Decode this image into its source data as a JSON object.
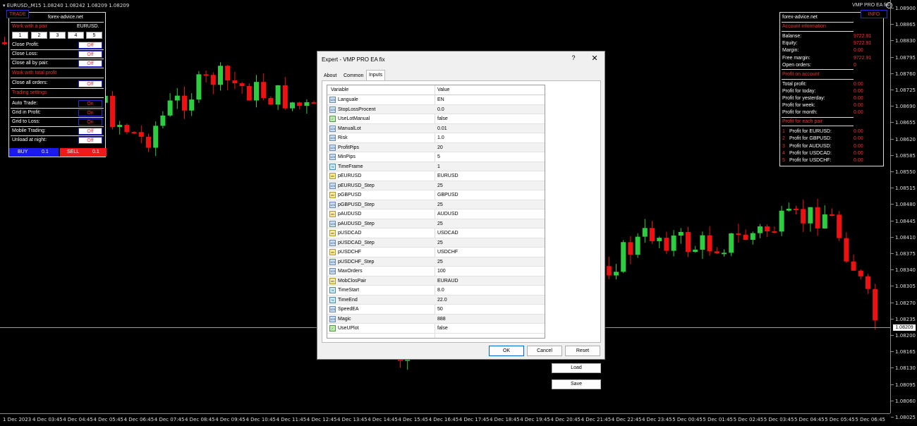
{
  "chart": {
    "symbol_info": "EURUSD,,M15  1.08240 1.08242 1.08209 1.08209",
    "ea_label": "VMP PRO EA fix",
    "current_price": "1.08209",
    "price_labels": [
      "1.08900",
      "1.08865",
      "1.08830",
      "1.08795",
      "1.08760",
      "1.08725",
      "1.08690",
      "1.08655",
      "1.08620",
      "1.08585",
      "1.08550",
      "1.08515",
      "1.08480",
      "1.08445",
      "1.08410",
      "1.08375",
      "1.08340",
      "1.08305",
      "1.08270",
      "1.08235",
      "1.08200",
      "1.08165",
      "1.08130",
      "1.08095",
      "1.08060",
      "1.08025"
    ],
    "time_labels": [
      "1 Dec 2023",
      "4 Dec 03:45",
      "4 Dec 04:45",
      "4 Dec 05:45",
      "4 Dec 06:45",
      "4 Dec 07:45",
      "4 Dec 08:45",
      "4 Dec 09:45",
      "4 Dec 10:45",
      "4 Dec 11:45",
      "4 Dec 12:45",
      "4 Dec 13:45",
      "4 Dec 14:45",
      "4 Dec 15:45",
      "4 Dec 16:45",
      "4 Dec 17:45",
      "4 Dec 18:45",
      "4 Dec 19:45",
      "4 Dec 20:45",
      "4 Dec 21:45",
      "4 Dec 22:45",
      "4 Dec 23:45",
      "5 Dec 00:45",
      "5 Dec 01:45",
      "5 Dec 02:45",
      "5 Dec 03:45",
      "5 Dec 04:45",
      "5 Dec 05:45",
      "5 Dec 06:45"
    ],
    "colors": {
      "bull": "#2ecc40",
      "bear": "#ee1111"
    }
  },
  "trade_panel": {
    "tab_trade": "TRADE",
    "tab_site": "forex-advice.net",
    "work_with_pair": "Work with a pair",
    "pair": "EURUSD.",
    "numbers": [
      "1",
      "2",
      "3",
      "4",
      "5"
    ],
    "close_profit": "Close Profit:",
    "close_loss": "Close Loss:",
    "close_all_by_pair": "Close all by pair:",
    "work_with_total_profit": "Work with total profit",
    "close_all_orders": "Close all orders:",
    "trading_settings": "Trading settings",
    "auto_trade": "Auto Trade:",
    "grid_in_profit": "Grid in Profit:",
    "grid_to_loss": "Grid to Loss:",
    "mobile_trading": "Mobile Trading:",
    "unload_at_night": "Unload at night:",
    "off": "Off",
    "on": "On",
    "buy": "BUY",
    "buy_lot": "0.1",
    "sell": "SELL",
    "sell_lot": "0.1"
  },
  "info_panel": {
    "tab_info": "INFO",
    "site": "forex-advice.net",
    "account_information": "Account information",
    "balance": "Balanse:",
    "balance_val": "9722.91",
    "equity": "Equity:",
    "equity_val": "9722.91",
    "margin": "Margin:",
    "margin_val": "0.00",
    "free_margin": "Free margin:",
    "free_margin_val": "9722.91",
    "open_orders": "Open orders:",
    "open_orders_val": "0",
    "profit_on_account": "Profit on account",
    "total_profit": "Total profit:",
    "total_profit_val": "0.00",
    "profit_today": "Profit for today:",
    "profit_today_val": "0.00",
    "profit_yesterday": "Profit for yesterday:",
    "profit_yesterday_val": "0.00",
    "profit_week": "Profit for week:",
    "profit_week_val": "0.00",
    "profit_month": "Profit for month:",
    "profit_month_val": "0.00",
    "profit_each_pair": "Profit for each pair",
    "pairs": [
      {
        "n": "1",
        "label": "Profit for EURUSD:",
        "val": "0.00"
      },
      {
        "n": "2",
        "label": "Profit for GBPUSD:",
        "val": "0.00"
      },
      {
        "n": "3",
        "label": "Profit for AUDUSD:",
        "val": "0.00"
      },
      {
        "n": "4",
        "label": "Profit for USDCAD:",
        "val": "0.00"
      },
      {
        "n": "5",
        "label": "Profit for USDCHF:",
        "val": "0.00"
      }
    ]
  },
  "dialog": {
    "title": "Expert - VMP PRO EA fix",
    "help": "?",
    "close": "✕",
    "tabs": [
      "About",
      "Common",
      "Inputs"
    ],
    "col_variable": "Variable",
    "col_value": "Value",
    "rows": [
      {
        "type": "123",
        "name": "Languale",
        "value": "EN"
      },
      {
        "type": "123",
        "name": "StopLossProcent",
        "value": "0.0"
      },
      {
        "type": "bool",
        "name": "UseLotManual",
        "value": "false"
      },
      {
        "type": "123",
        "name": "ManualLot",
        "value": "0.01"
      },
      {
        "type": "123",
        "name": "Risk",
        "value": "1.0"
      },
      {
        "type": "123",
        "name": "ProfitPips",
        "value": "20"
      },
      {
        "type": "123",
        "name": "MinPips",
        "value": "5"
      },
      {
        "type": "tm",
        "name": "TimeFrame",
        "value": "1"
      },
      {
        "type": "ab",
        "name": "pEURUSD",
        "value": "EURUSD"
      },
      {
        "type": "123",
        "name": "pEURUSD_Step",
        "value": "25"
      },
      {
        "type": "ab",
        "name": "pGBPUSD",
        "value": "GBPUSD"
      },
      {
        "type": "123",
        "name": "pGBPUSD_Step",
        "value": "25"
      },
      {
        "type": "ab",
        "name": "pAUDUSD",
        "value": "AUDUSD"
      },
      {
        "type": "123",
        "name": "pAUDUSD_Step",
        "value": "25"
      },
      {
        "type": "ab",
        "name": "pUSDCAD",
        "value": "USDCAD"
      },
      {
        "type": "123",
        "name": "pUSDCAD_Step",
        "value": "25"
      },
      {
        "type": "ab",
        "name": "pUSDCHF",
        "value": "USDCHF"
      },
      {
        "type": "123",
        "name": "pUSDCHF_Step",
        "value": "25"
      },
      {
        "type": "123",
        "name": "MaxOrders",
        "value": "100"
      },
      {
        "type": "ab",
        "name": "MobClosPair",
        "value": "EURAUD"
      },
      {
        "type": "tm",
        "name": "TimeStart",
        "value": "8.0"
      },
      {
        "type": "tm",
        "name": "TimeEnd",
        "value": "22.0"
      },
      {
        "type": "123",
        "name": "SpeedEA",
        "value": "50"
      },
      {
        "type": "123",
        "name": "Magic",
        "value": "888"
      },
      {
        "type": "bool",
        "name": "UseUPlot",
        "value": "false"
      }
    ],
    "load": "Load",
    "save": "Save",
    "ok": "OK",
    "cancel": "Cancel",
    "reset": "Reset"
  }
}
